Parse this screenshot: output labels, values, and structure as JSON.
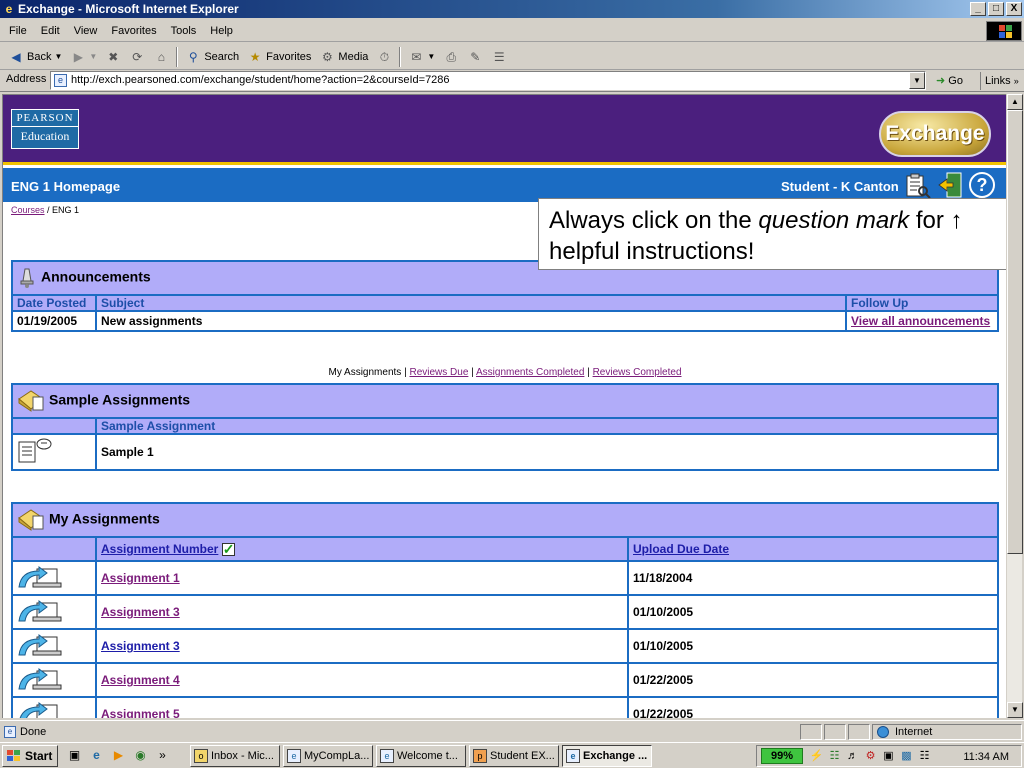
{
  "window": {
    "title": "Exchange - Microsoft Internet Explorer",
    "buttons": [
      "_",
      "□",
      "X"
    ]
  },
  "menu": [
    "File",
    "Edit",
    "View",
    "Favorites",
    "Tools",
    "Help"
  ],
  "toolbar": {
    "back": "Back",
    "search": "Search",
    "favorites": "Favorites",
    "media": "Media"
  },
  "address": {
    "label": "Address",
    "url": "http://exch.pearsoned.com/exchange/student/home?action=2&courseId=7286",
    "go": "Go",
    "links": "Links"
  },
  "page": {
    "pearson_top": "PEARSON",
    "pearson_bottom": "Education",
    "exchange_logo": "Exchange",
    "course_title": "ENG 1 Homepage",
    "student": "Student - K Canton",
    "help": "?",
    "breadcrumb": {
      "courses": "Courses",
      "separator": "/ ENG 1"
    }
  },
  "callout": {
    "before": "Always click on the ",
    "italic": "question mark",
    "after": " for ↑ helpful instructions!"
  },
  "announcements": {
    "title": "Announcements",
    "headers": [
      "Date Posted",
      "Subject",
      "Follow Up"
    ],
    "rows": [
      {
        "date": "01/19/2005",
        "subject": "New assignments",
        "follow": "View all announcements"
      }
    ]
  },
  "tabs": {
    "current": "My Assignments",
    "sep": "|",
    "reviews_due": "Reviews Due",
    "assignments_completed": "Assignments Completed",
    "reviews_completed": "Reviews Completed"
  },
  "samples": {
    "title": "Sample Assignments",
    "header": "Sample Assignment",
    "rows": [
      {
        "name": "Sample 1"
      }
    ]
  },
  "my_assignments": {
    "title": "My Assignments",
    "headers": [
      "Assignment Number",
      "Upload Due Date"
    ],
    "rows": [
      {
        "name": "Assignment 1",
        "due": "11/18/2004",
        "visited": true
      },
      {
        "name": "Assignment 3",
        "due": "01/10/2005",
        "visited": true
      },
      {
        "name": "Assignment 3",
        "due": "01/10/2005",
        "visited": false
      },
      {
        "name": "Assignment 4",
        "due": "01/22/2005",
        "visited": true
      },
      {
        "name": "Assignment 5",
        "due": "01/22/2005",
        "visited": true
      }
    ]
  },
  "status": {
    "text": "Done",
    "zone": "Internet"
  },
  "taskbar": {
    "start": "Start",
    "tasks": [
      "Inbox - Mic...",
      "MyCompLa...",
      "Welcome t...",
      "Student EX...",
      "Exchange ..."
    ],
    "battery": "99%",
    "clock": "11:34 AM"
  },
  "colors": {
    "header_purple": "#4b1f7e",
    "bar_blue": "#1b6cc3",
    "table_header": "#b1acf9",
    "gold": "#f2c200"
  }
}
